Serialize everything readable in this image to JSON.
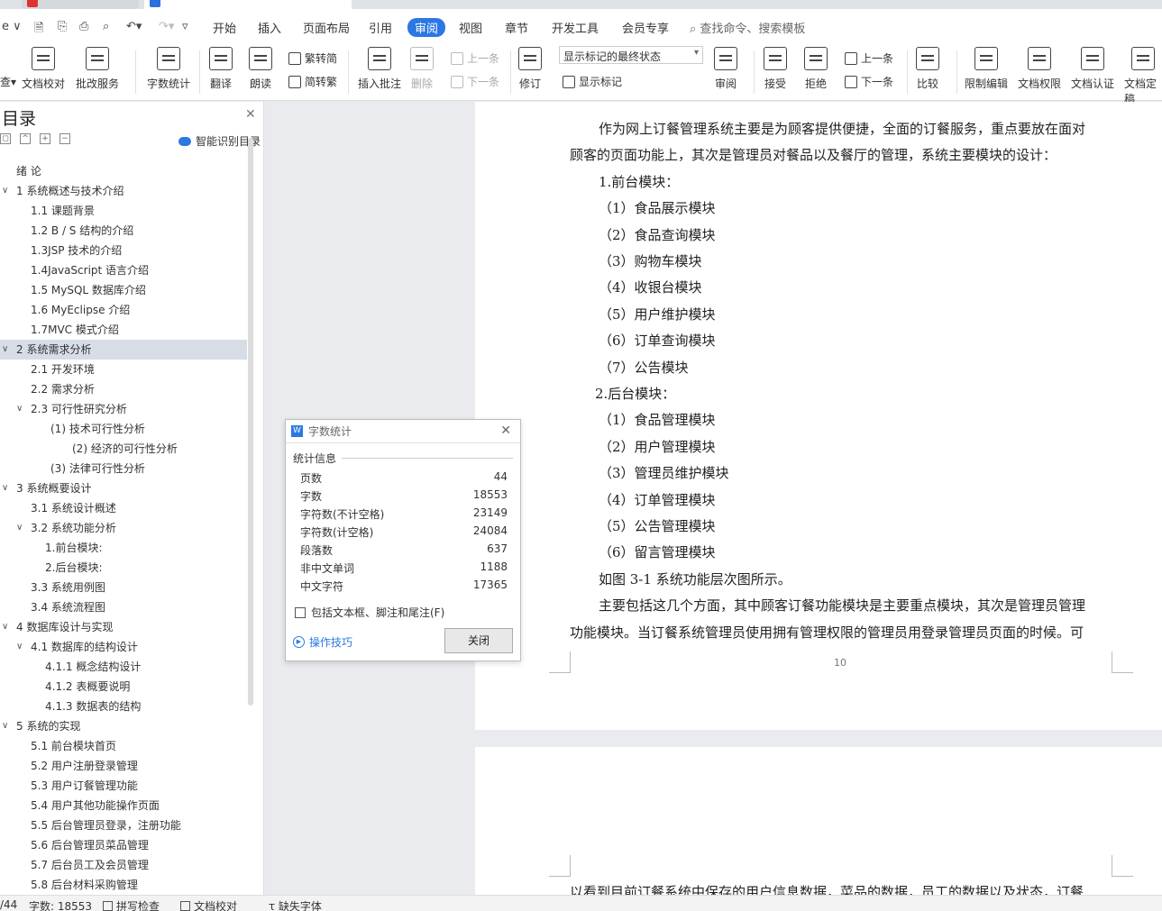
{
  "quick_access": {
    "left_label": "e ∨"
  },
  "menu": [
    {
      "label": "开始",
      "active": false
    },
    {
      "label": "插入",
      "active": false
    },
    {
      "label": "页面布局",
      "active": false
    },
    {
      "label": "引用",
      "active": false
    },
    {
      "label": "审阅",
      "active": true
    },
    {
      "label": "视图",
      "active": false
    },
    {
      "label": "章节",
      "active": false
    },
    {
      "label": "开发工具",
      "active": false
    },
    {
      "label": "会员专享",
      "active": false
    }
  ],
  "search_placeholder": "查找命令、搜索模板",
  "ribbon": {
    "doc_check": "文档校对",
    "batch": "批改服务",
    "word_count": "字数统计",
    "translate": "翻译",
    "read": "朗读",
    "trad": "繁转简",
    "simp": "简转繁",
    "insert_comment": "插入批注",
    "delete": "删除",
    "prev": "上一条",
    "next": "下一条",
    "revise": "修订",
    "markup_mode": "显示标记的最终状态",
    "show_markup": "显示标记",
    "review": "审阅",
    "accept": "接受",
    "reject": "拒绝",
    "prev2": "上一条",
    "next2": "下一条",
    "compare": "比较",
    "restrict": "限制编辑",
    "perm": "文档权限",
    "auth": "文档认证",
    "final": "文档定稿"
  },
  "toc": {
    "title": "目录",
    "smart": "智能识别目录",
    "items": [
      {
        "label": "绪  论",
        "level": 0,
        "chev": ""
      },
      {
        "label": "1   系统概述与技术介绍",
        "level": 0,
        "chev": "∨"
      },
      {
        "label": "1.1  课题背景",
        "level": 1,
        "chev": ""
      },
      {
        "label": "1.2 B / S 结构的介绍",
        "level": 1,
        "chev": ""
      },
      {
        "label": "1.3JSP 技术的介绍",
        "level": 1,
        "chev": ""
      },
      {
        "label": "1.4JavaScript 语言介绍",
        "level": 1,
        "chev": ""
      },
      {
        "label": "1.5    MySQL 数据库介绍",
        "level": 1,
        "chev": ""
      },
      {
        "label": "1.6    MyEclipse 介绍",
        "level": 1,
        "chev": ""
      },
      {
        "label": "1.7MVC 模式介绍",
        "level": 1,
        "chev": ""
      },
      {
        "label": "2   系统需求分析",
        "level": 0,
        "chev": "∨",
        "sel": true
      },
      {
        "label": "2.1    开发环境",
        "level": 1,
        "chev": ""
      },
      {
        "label": "2.2    需求分析",
        "level": 1,
        "chev": ""
      },
      {
        "label": "2.3    可行性研究分析",
        "level": 1,
        "chev": "∨"
      },
      {
        "label": "(1)  技术可行性分析",
        "level": 2,
        "chev": ""
      },
      {
        "label": "(2)  经济的可行性分析",
        "level": 3,
        "chev": ""
      },
      {
        "label": "(3)  法律可行性分析",
        "level": 2,
        "chev": ""
      },
      {
        "label": "3   系统概要设计",
        "level": 0,
        "chev": "∨"
      },
      {
        "label": "3.1    系统设计概述",
        "level": 1,
        "chev": ""
      },
      {
        "label": "3.2    系统功能分析",
        "level": 1,
        "chev": "∨"
      },
      {
        "label": "1.前台模块:",
        "level": 4,
        "chev": ""
      },
      {
        "label": "2.后台模块:",
        "level": 4,
        "chev": ""
      },
      {
        "label": "3.3    系统用例图",
        "level": 1,
        "chev": ""
      },
      {
        "label": "3.4    系统流程图",
        "level": 1,
        "chev": ""
      },
      {
        "label": "4   数据库设计与实现",
        "level": 0,
        "chev": "∨"
      },
      {
        "label": "4.1    数据库的结构设计",
        "level": 1,
        "chev": "∨"
      },
      {
        "label": "4.1.1 概念结构设计",
        "level": 4,
        "chev": ""
      },
      {
        "label": "4.1.2    表概要说明",
        "level": 4,
        "chev": ""
      },
      {
        "label": "4.1.3    数据表的结构",
        "level": 4,
        "chev": ""
      },
      {
        "label": "5 系统的实现",
        "level": 0,
        "chev": "∨"
      },
      {
        "label": "5.1    前台模块首页",
        "level": 1,
        "chev": ""
      },
      {
        "label": "5.2 用户注册登录管理",
        "level": 1,
        "chev": ""
      },
      {
        "label": "5.3 用户订餐管理功能",
        "level": 1,
        "chev": ""
      },
      {
        "label": "5.4 用户其他功能操作页面",
        "level": 1,
        "chev": ""
      },
      {
        "label": "5.5 后台管理员登录，注册功能",
        "level": 1,
        "chev": ""
      },
      {
        "label": "5.6 后台管理员菜品管理",
        "level": 1,
        "chev": ""
      },
      {
        "label": "5.7 后台员工及会员管理",
        "level": 1,
        "chev": ""
      },
      {
        "label": "5.8 后台材料采购管理",
        "level": 1,
        "chev": ""
      }
    ]
  },
  "page": {
    "lines": [
      {
        "text": "作为网上订餐管理系统主要是为顾客提供便捷，全面的订餐服务，重点要放在面对",
        "indent": 1
      },
      {
        "text": "顾客的页面功能上，其次是管理员对餐品以及餐厅的管理，系统主要模块的设计：",
        "indent": 0
      },
      {
        "text": "1.前台模块：",
        "indent": 1
      },
      {
        "text": "（1）食品展示模块",
        "indent": 2
      },
      {
        "text": "（2）食品查询模块",
        "indent": 2
      },
      {
        "text": "（3）购物车模块",
        "indent": 2
      },
      {
        "text": "（4）收银台模块",
        "indent": 2
      },
      {
        "text": "（5）用户维护模块",
        "indent": 2
      },
      {
        "text": "（6）订单查询模块",
        "indent": 2
      },
      {
        "text": "（7）公告模块",
        "indent": 2
      },
      {
        "text": "2.后台模块：",
        "indent": 3
      },
      {
        "text": "（1）食品管理模块",
        "indent": 2
      },
      {
        "text": "（2）用户管理模块",
        "indent": 2
      },
      {
        "text": "（3）管理员维护模块",
        "indent": 2
      },
      {
        "text": "（4）订单管理模块",
        "indent": 2
      },
      {
        "text": "（5）公告管理模块",
        "indent": 2
      },
      {
        "text": "（6）留言管理模块",
        "indent": 2
      },
      {
        "text": "如图 3-1 系统功能层次图所示。",
        "indent": 1
      },
      {
        "text": "主要包括这几个方面，其中顾客订餐功能模块是主要重点模块，其次是管理员管理",
        "indent": 1
      },
      {
        "text": "功能模块。当订餐系统管理员使用拥有管理权限的管理员用登录管理员页面的时候。可",
        "indent": 0
      }
    ],
    "page_number": "10",
    "next_page_line": "以看到目前订餐系统中保存的用户信息数据，菜品的数据，员工的数据以及状态，订餐"
  },
  "dialog": {
    "title": "字数统计",
    "section": "统计信息",
    "stats": [
      {
        "label": "页数",
        "value": "44"
      },
      {
        "label": "字数",
        "value": "18553"
      },
      {
        "label": "字符数(不计空格)",
        "value": "23149"
      },
      {
        "label": "字符数(计空格)",
        "value": "24084"
      },
      {
        "label": "段落数",
        "value": "637"
      },
      {
        "label": "非中文单词",
        "value": "1188"
      },
      {
        "label": "中文字符",
        "value": "17365"
      }
    ],
    "include_label": "包括文本框、脚注和尾注(F)",
    "tips": "操作技巧",
    "close": "关闭"
  },
  "status": {
    "page": "/44",
    "words": "字数: 18553",
    "spell": "拼写检查",
    "proof": "文档校对",
    "missing_font": "缺失字体"
  }
}
